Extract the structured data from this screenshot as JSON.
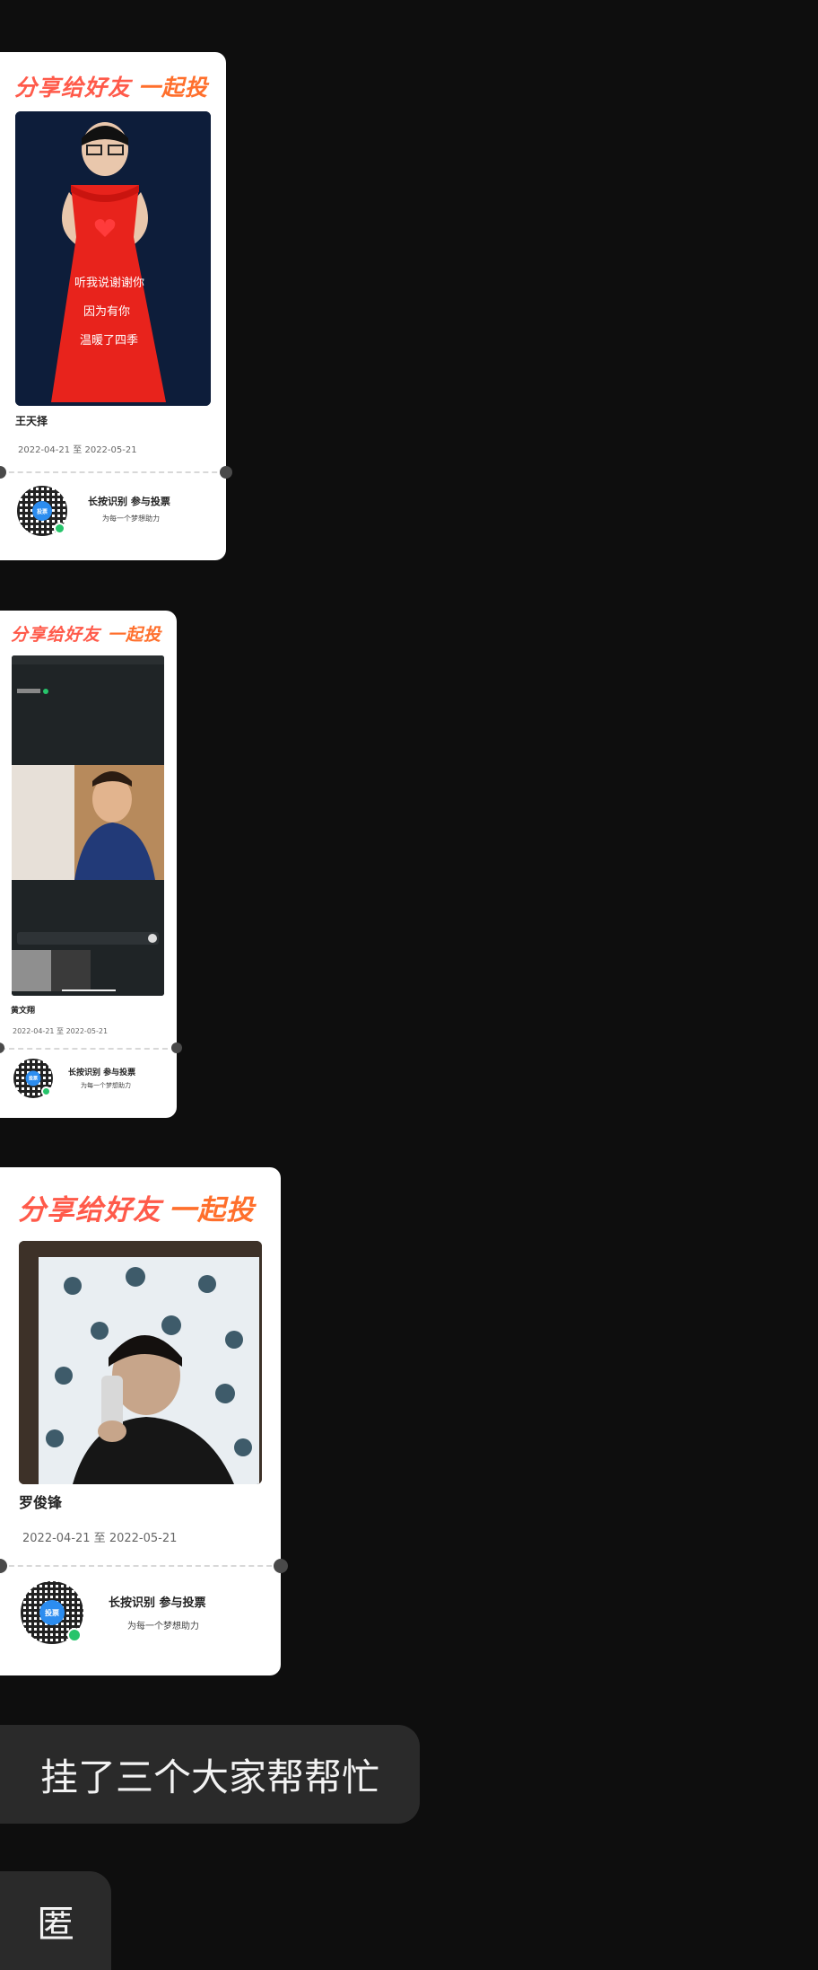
{
  "cards": [
    {
      "headline": "分享给好友",
      "headline_accent": "一起投",
      "name": "王天择",
      "date_range": "2022-04-21 至 2022-05-21",
      "qr_center_text": "投票",
      "cta_main": "长按识别  参与投票",
      "cta_sub": "为每一个梦想助力",
      "photo_caption_lines": [
        "听我说谢谢你",
        "因为有你",
        "温暖了四季"
      ]
    },
    {
      "headline": "分享给好友",
      "headline_accent": "一起投",
      "name": "黄文翔",
      "date_range": "2022-04-21 至 2022-05-21",
      "qr_center_text": "投票",
      "cta_main": "长按识别  参与投票",
      "cta_sub": "为每一个梦想助力"
    },
    {
      "headline": "分享给好友",
      "headline_accent": "一起投",
      "name": "罗俊锋",
      "date_range": "2022-04-21 至 2022-05-21",
      "qr_center_text": "投票",
      "cta_main": "长按识别  参与投票",
      "cta_sub": "为每一个梦想助力"
    }
  ],
  "messages": [
    {
      "text": "挂了三个大家帮帮忙"
    },
    {
      "text": "匿"
    }
  ],
  "colors": {
    "background": "#0e0e0e",
    "bubble": "#2a2a2a",
    "headline": "#ff5a4a",
    "qr_center": "#2c8df0",
    "badge": "#27c46b"
  }
}
